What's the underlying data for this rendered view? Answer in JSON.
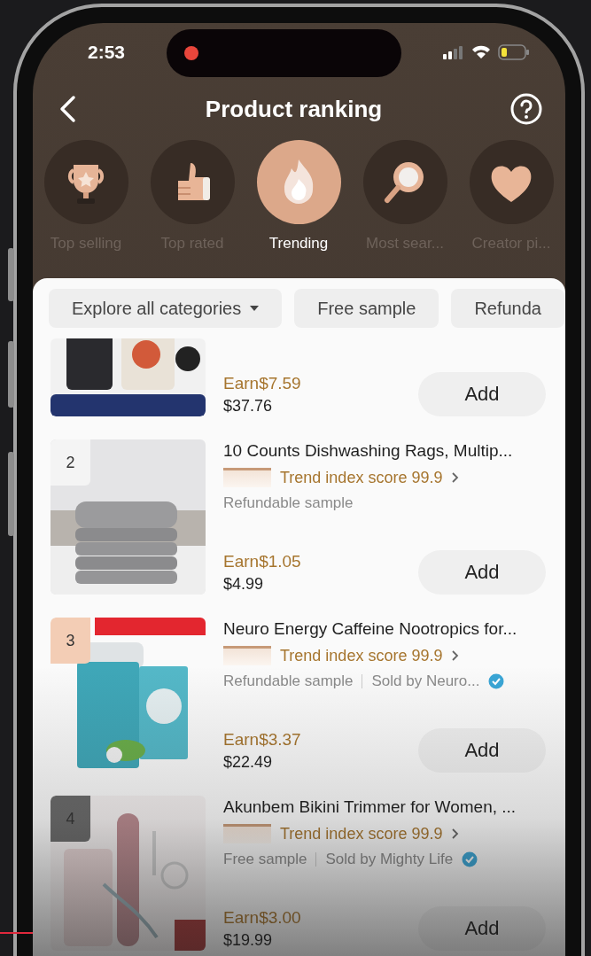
{
  "status_bar": {
    "time": "2:53",
    "recording": true
  },
  "header": {
    "title": "Product ranking"
  },
  "categories": [
    {
      "label": "Top selling",
      "selected": false
    },
    {
      "label": "Top rated",
      "selected": false
    },
    {
      "label": "Trending",
      "selected": true
    },
    {
      "label": "Most sear...",
      "selected": false
    },
    {
      "label": "Creator pi...",
      "selected": false
    }
  ],
  "filters": [
    {
      "label": "Explore all categories",
      "dropdown": true
    },
    {
      "label": "Free sample",
      "dropdown": false
    },
    {
      "label": "Refunda",
      "dropdown": false
    }
  ],
  "products": [
    {
      "earn": "Earn$7.59",
      "price": "$37.76",
      "button": "Add"
    },
    {
      "rank": "2",
      "color": "#f4f4f4",
      "title": "10 Counts Dishwashing Rags,  Multip...",
      "trend": "Trend index score 99.9",
      "sample": "Refundable sample",
      "earn": "Earn$1.05",
      "price": "$4.99",
      "button": "Add"
    },
    {
      "rank": "3",
      "color": "#f3cdb5",
      "title": "Neuro Energy Caffeine Nootropics for...",
      "trend": "Trend index score 99.9",
      "sample": "Refundable sample",
      "seller": "Sold by Neuro...",
      "verified": true,
      "earn": "Earn$3.37",
      "price": "$22.49",
      "button": "Add"
    },
    {
      "rank": "4",
      "color": "#6a6a6a",
      "title": "Akunbem Bikini Trimmer for Women, ...",
      "trend": "Trend index score 99.9",
      "sample": "Free sample",
      "seller": "Sold by Mighty Life",
      "verified": true,
      "earn": "Earn$3.00",
      "price": "$19.99",
      "button": "Add"
    }
  ]
}
